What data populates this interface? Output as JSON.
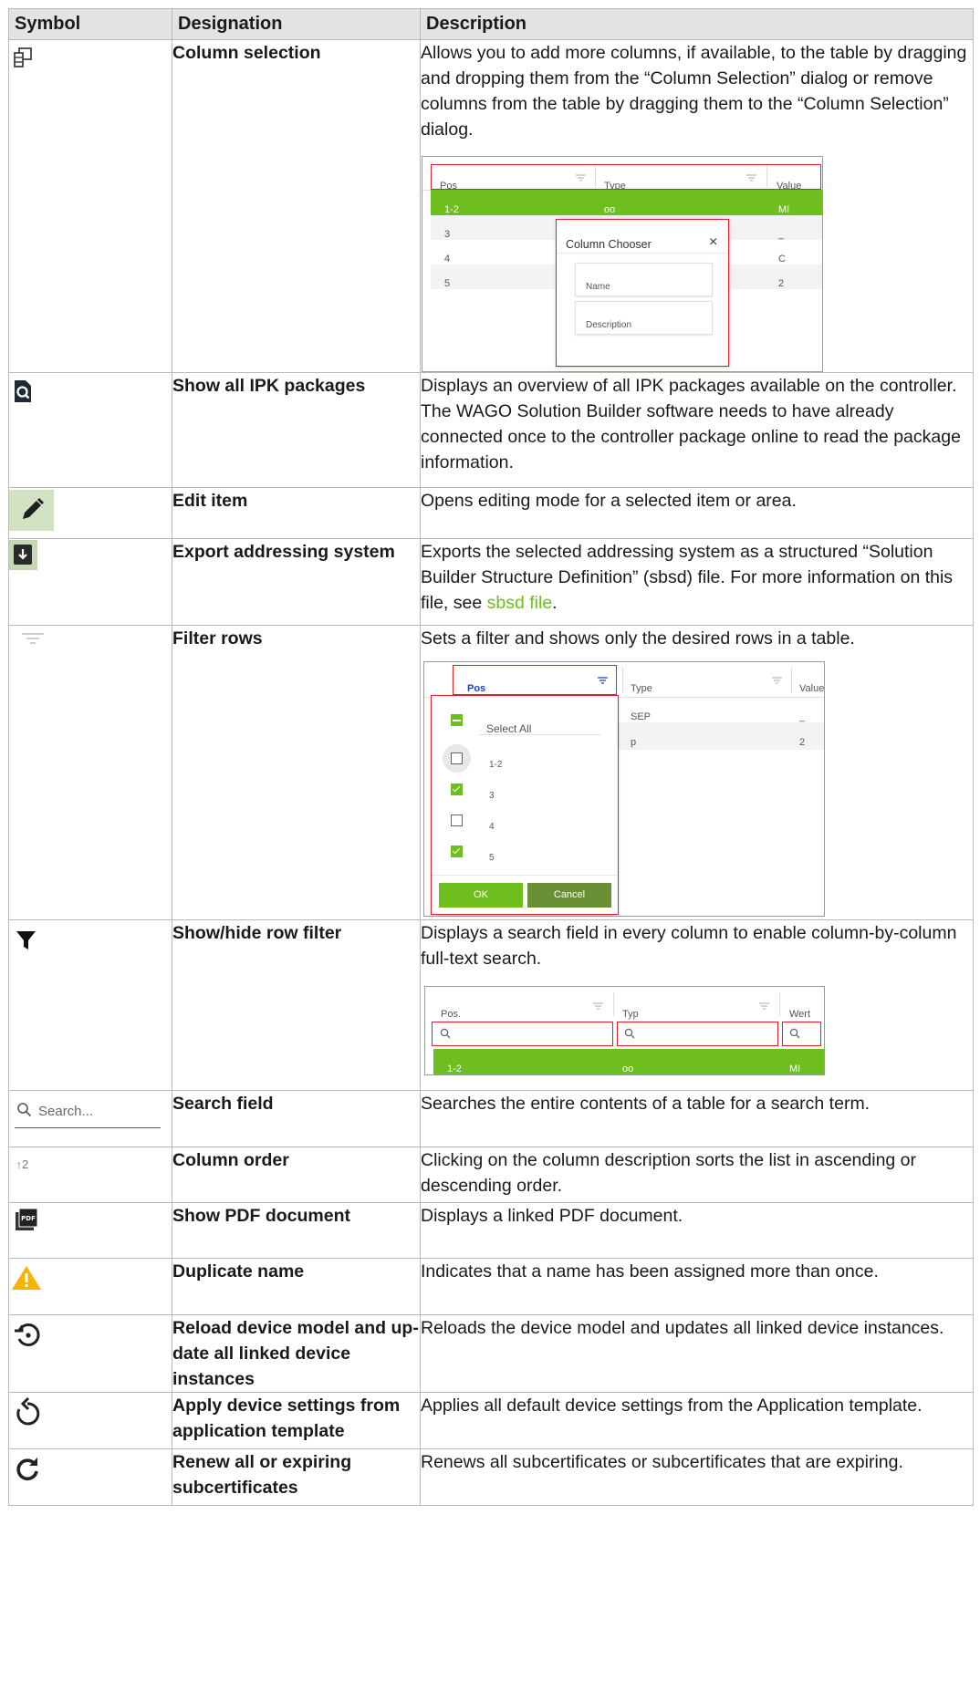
{
  "header": {
    "symbol": "Symbol",
    "designation": "Designation",
    "description": "Description"
  },
  "rows": [
    {
      "icon": "column-selection-icon",
      "designation": "Column selection",
      "description": "Allows you to add more columns, if available, to the table by dragging and dropping them from the “Column Selec­tion” dialog or remove columns from the table by drag­ging them to the “Column Selection” dialog."
    },
    {
      "icon": "ipk-packages-icon",
      "designation": "Show all IPK packages",
      "description": "Displays an overview of all IPK packages available on the controller. The WAGO Solution Builder software needs to have already connected once to the controller package online to read the package information."
    },
    {
      "icon": "pencil-icon",
      "designation": "Edit item",
      "description": "Opens editing mode for a selected item or area."
    },
    {
      "icon": "export-icon",
      "designation": "Export addressing system",
      "description_before": "Exports the selected addressing system as a structured “Solution Builder Structure Definition” (sbsd) file. For more information on this file, see ",
      "description_link": "sbsd file",
      "description_after": "."
    },
    {
      "icon": "filter-rows-icon",
      "designation": "Filter rows",
      "description": "Sets a filter and shows only the desired rows in a table."
    },
    {
      "icon": "funnel-icon",
      "designation": "Show/hide row filter",
      "description": "Displays a search field in every column to enable column-by-column full-text search."
    },
    {
      "icon": "search-icon",
      "icon_text": "Search...",
      "designation": "Search field",
      "description": "Searches the entire contents of a table for a search term."
    },
    {
      "icon": "sort-up-icon",
      "icon_text": "2",
      "designation": "Column order",
      "description": "Clicking on the column description sorts the list in as­cending or descending order."
    },
    {
      "icon": "pdf-icon",
      "designation": "Show PDF document",
      "description": "Displays a linked PDF document."
    },
    {
      "icon": "warning-icon",
      "designation": "Duplicate name",
      "description": "Indicates that a name has been assigned more than once."
    },
    {
      "icon": "reload-icon",
      "designation": "Reload device model and up­date all linked device instances",
      "description": "Reloads the device model and updates all linked device instances."
    },
    {
      "icon": "restore-icon",
      "designation": "Apply device settings from ap­plication template",
      "description": "Applies all default device settings from the Application template."
    },
    {
      "icon": "refresh-icon",
      "designation": "Renew all or expiring subcer­tificates",
      "description": "Renews all subcertificates or subcertificates that are ex­piring."
    }
  ],
  "shot_column_chooser": {
    "headers": [
      "Pos",
      "Type",
      "Value"
    ],
    "rows": [
      [
        "1-2",
        "oo",
        "MI"
      ],
      [
        "3",
        "",
        "_"
      ],
      [
        "4",
        "",
        "C"
      ],
      [
        "5",
        "",
        "2"
      ]
    ],
    "dialog_title": "Column Chooser",
    "dialog_items": [
      "Name",
      "Description"
    ],
    "close": "×"
  },
  "shot_filter": {
    "headers": [
      "Pos",
      "Type",
      "Value"
    ],
    "rows": [
      [
        "SEP",
        "_"
      ],
      [
        "p",
        "2"
      ]
    ],
    "select_all": "Select All",
    "options": [
      {
        "label": "1-2",
        "checked": false
      },
      {
        "label": "3",
        "checked": true
      },
      {
        "label": "4",
        "checked": false
      },
      {
        "label": "5",
        "checked": true
      }
    ],
    "ok": "OK",
    "cancel": "Cancel"
  },
  "shot_row_filter": {
    "headers": [
      "Pos.",
      "Typ",
      "Wert"
    ],
    "rows": [
      [
        "1-2",
        "oo",
        "MI"
      ]
    ]
  },
  "colors": {
    "accent_green": "#6ebe1e",
    "dark_green": "#6b8f35",
    "highlight_red": "#e0202a",
    "header_gray": "#e3e3e3"
  }
}
